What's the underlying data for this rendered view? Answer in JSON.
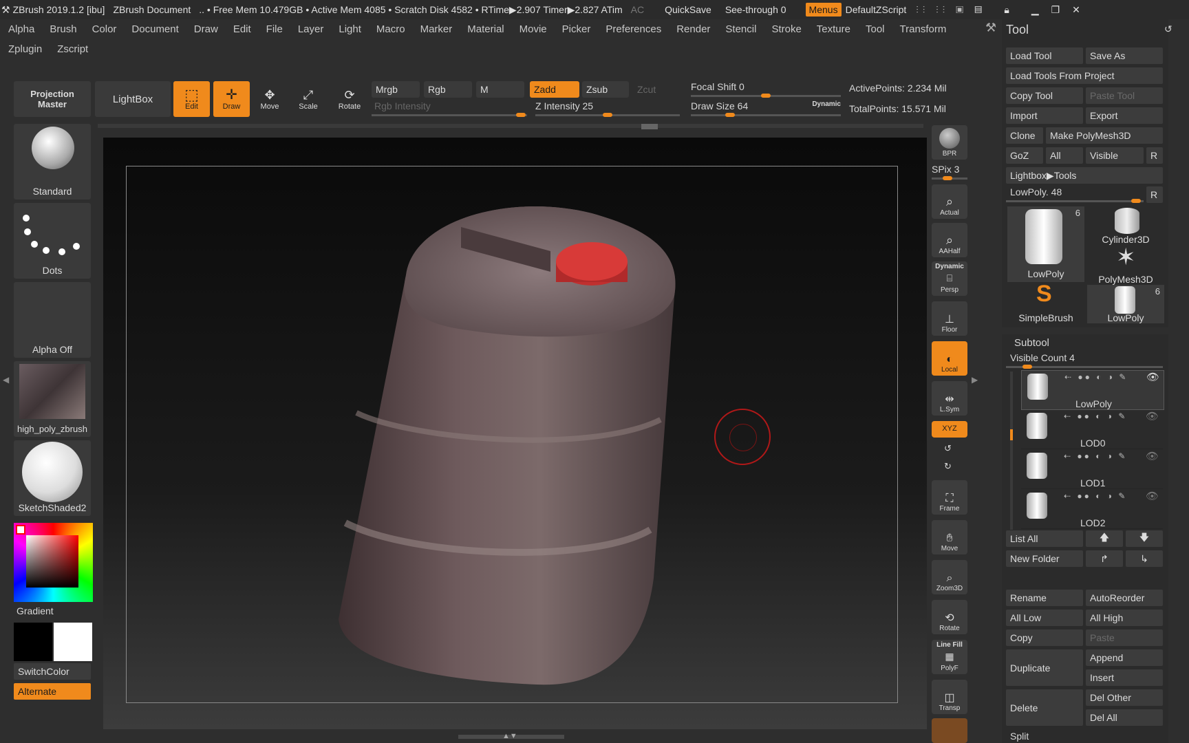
{
  "titlebar": {
    "app": "ZBrush 2019.1.2 [ibu]",
    "document": "ZBrush Document",
    "stats": ".. • Free Mem 10.479GB • Active Mem 4085 • Scratch Disk 4582 • RTime▶2.907 Timer▶2.827 ATim",
    "ac": "AC",
    "quicksave": "QuickSave",
    "seethrough": "See-through 0",
    "menus": "Menus",
    "script": "DefaultZScript"
  },
  "menubar": [
    "Alpha",
    "Brush",
    "Color",
    "Document",
    "Draw",
    "Edit",
    "File",
    "Layer",
    "Light",
    "Macro",
    "Marker",
    "Material",
    "Movie",
    "Picker",
    "Preferences",
    "Render",
    "Stencil",
    "Stroke",
    "Texture",
    "Tool",
    "Transform",
    "Zplugin",
    "Zscript"
  ],
  "toolbar": {
    "projection_master": "Projection Master",
    "lightbox": "LightBox",
    "edit": "Edit",
    "draw": "Draw",
    "move": "Move",
    "scale": "Scale",
    "rotate": "Rotate",
    "mrgb": "Mrgb",
    "rgb": "Rgb",
    "m": "M",
    "zadd": "Zadd",
    "zsub": "Zsub",
    "zcut": "Zcut",
    "rgb_intensity": "Rgb Intensity",
    "z_intensity": "Z Intensity 25",
    "focal_shift": "Focal Shift 0",
    "draw_size": "Draw Size 64",
    "dynamic": "Dynamic",
    "active_points": "ActivePoints: 2.234 Mil",
    "total_points": "TotalPoints: 15.571 Mil"
  },
  "left": {
    "standard": "Standard",
    "dots": "Dots",
    "alpha_off": "Alpha Off",
    "texture": "high_poly_zbrush",
    "material": "SketchShaded2",
    "gradient": "Gradient",
    "switchcolor": "SwitchColor",
    "alternate": "Alternate"
  },
  "shelf": {
    "bpr": "BPR",
    "spix": "SPix 3",
    "actual": "Actual",
    "aahalf": "AAHalf",
    "dynamic": "Dynamic",
    "persp": "Persp",
    "floor": "Floor",
    "local": "Local",
    "lsym": "L.Sym",
    "xyz": "XYZ",
    "frame": "Frame",
    "move": "Move",
    "zoom3d": "Zoom3D",
    "rotate": "Rotate",
    "linefill": "Line Fill",
    "polyf": "PolyF",
    "transp": "Transp"
  },
  "tool": {
    "title": "Tool",
    "load_tool": "Load Tool",
    "save_as": "Save As",
    "load_from_project": "Load Tools From Project",
    "copy_tool": "Copy Tool",
    "paste_tool": "Paste Tool",
    "import": "Import",
    "export": "Export",
    "clone": "Clone",
    "make_polymesh": "Make PolyMesh3D",
    "goz": "GoZ",
    "all": "All",
    "visible": "Visible",
    "r": "R",
    "lightbox_tools": "Lightbox▶Tools",
    "lowpoly_slider": "LowPoly. 48",
    "thumbs": [
      "LowPoly",
      "Cylinder3D",
      "PolyMesh3D",
      "SimpleBrush",
      "LowPoly"
    ],
    "count_a": "6",
    "count_b": "6"
  },
  "subtool": {
    "title": "Subtool",
    "visible_count": "Visible Count 4",
    "items": [
      "LowPoly",
      "LOD0",
      "LOD1",
      "LOD2"
    ],
    "list_all": "List All",
    "new_folder": "New Folder",
    "rename": "Rename",
    "autoreorder": "AutoReorder",
    "all_low": "All Low",
    "all_high": "All High",
    "copy": "Copy",
    "paste": "Paste",
    "duplicate": "Duplicate",
    "append": "Append",
    "insert": "Insert",
    "delete": "Delete",
    "del_other": "Del Other",
    "del_all": "Del All",
    "split": "Split"
  }
}
